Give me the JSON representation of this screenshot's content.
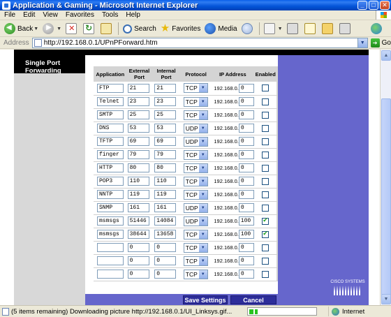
{
  "window": {
    "title": "Application & Gaming - Microsoft Internet Explorer"
  },
  "menu": [
    "File",
    "Edit",
    "View",
    "Favorites",
    "Tools",
    "Help"
  ],
  "toolbar": {
    "back_label": "Back",
    "search_label": "Search",
    "favorites_label": "Favorites",
    "media_label": "Media"
  },
  "address": {
    "label": "Address",
    "url": "http://192.168.0.1/UPnPForward.htm",
    "go_label": "Go"
  },
  "page": {
    "section_label": "Single Port Forwarding",
    "columns": {
      "application": "Application",
      "external_port": "External Port",
      "internal_port": "Internal Port",
      "protocol": "Protocol",
      "ip_address": "IP Address",
      "enabled": "Enabled"
    },
    "ip_prefix": "192.168.0.",
    "rows": [
      {
        "app": "FTP",
        "ext": "21",
        "int": "21",
        "proto": "TCP",
        "ip": "0",
        "enabled": false
      },
      {
        "app": "Telnet",
        "ext": "23",
        "int": "23",
        "proto": "TCP",
        "ip": "0",
        "enabled": false
      },
      {
        "app": "SMTP",
        "ext": "25",
        "int": "25",
        "proto": "TCP",
        "ip": "0",
        "enabled": false
      },
      {
        "app": "DNS",
        "ext": "53",
        "int": "53",
        "proto": "UDP",
        "ip": "0",
        "enabled": false
      },
      {
        "app": "TFTP",
        "ext": "69",
        "int": "69",
        "proto": "UDP",
        "ip": "0",
        "enabled": false
      },
      {
        "app": "finger",
        "ext": "79",
        "int": "79",
        "proto": "TCP",
        "ip": "0",
        "enabled": false
      },
      {
        "app": "HTTP",
        "ext": "80",
        "int": "80",
        "proto": "TCP",
        "ip": "0",
        "enabled": false
      },
      {
        "app": "POP3",
        "ext": "110",
        "int": "110",
        "proto": "TCP",
        "ip": "0",
        "enabled": false
      },
      {
        "app": "NNTP",
        "ext": "119",
        "int": "119",
        "proto": "TCP",
        "ip": "0",
        "enabled": false
      },
      {
        "app": "SNMP",
        "ext": "161",
        "int": "161",
        "proto": "UDP",
        "ip": "0",
        "enabled": false
      },
      {
        "app": "msmsgs",
        "ext": "51446",
        "int": "14084",
        "proto": "UDP",
        "ip": "100",
        "enabled": true
      },
      {
        "app": "msmsgs",
        "ext": "38644",
        "int": "13658",
        "proto": "TCP",
        "ip": "100",
        "enabled": true
      },
      {
        "app": "",
        "ext": "0",
        "int": "0",
        "proto": "TCP",
        "ip": "0",
        "enabled": false
      },
      {
        "app": "",
        "ext": "0",
        "int": "0",
        "proto": "TCP",
        "ip": "0",
        "enabled": false
      },
      {
        "app": "",
        "ext": "0",
        "int": "0",
        "proto": "TCP",
        "ip": "0",
        "enabled": false
      }
    ],
    "save_label": "Save Settings",
    "cancel_label": "Cancel Changes",
    "logo_text": "CISCO SYSTEMS"
  },
  "status": {
    "text": "(5 items remaining) Downloading picture http://192.168.0.1/UI_Linksys.gif...",
    "progress": 0.12,
    "zone": "Internet"
  }
}
